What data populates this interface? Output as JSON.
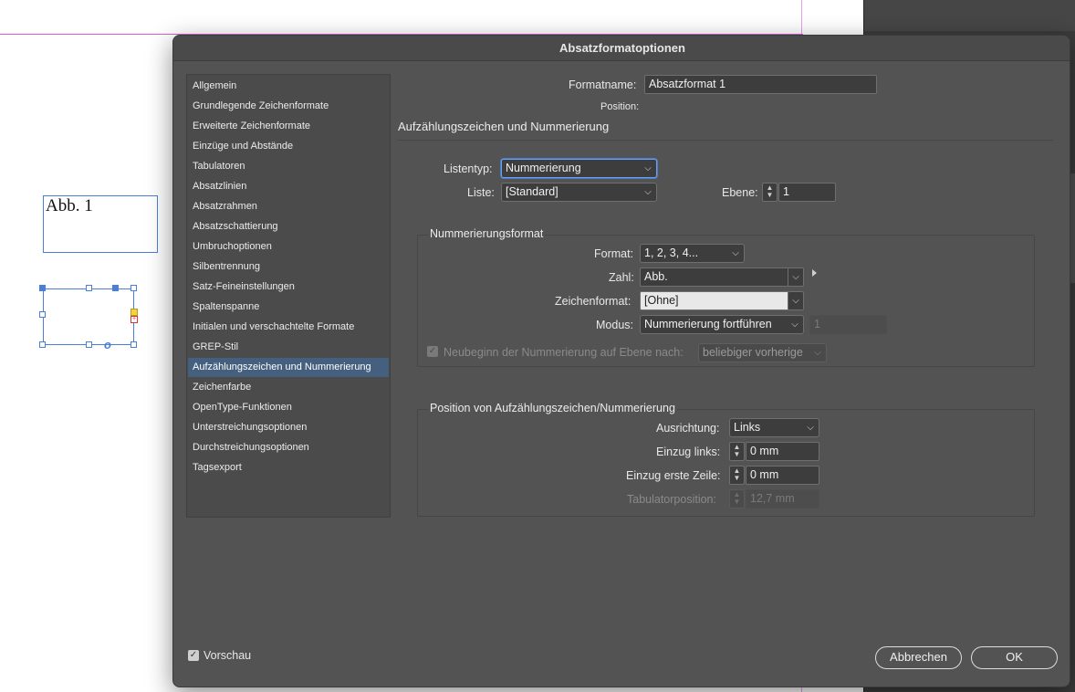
{
  "document": {
    "frame_text": "Abb. 1"
  },
  "dialog": {
    "title": "Absatzformatoptionen",
    "categories": [
      "Allgemein",
      "Grundlegende Zeichenformate",
      "Erweiterte Zeichenformate",
      "Einzüge und Abstände",
      "Tabulatoren",
      "Absatzlinien",
      "Absatzrahmen",
      "Absatzschattierung",
      "Umbruchoptionen",
      "Silbentrennung",
      "Satz-Feineinstellungen",
      "Spaltenspanne",
      "Initialen und verschachtelte Formate",
      "GREP-Stil",
      "Aufzählungszeichen und Nummerierung",
      "Zeichenfarbe",
      "OpenType-Funktionen",
      "Unterstreichungsoptionen",
      "Durchstreichungsoptionen",
      "Tagsexport"
    ],
    "selected_category": "Aufzählungszeichen und Nummerierung",
    "format_name_label": "Formatname:",
    "format_name_value": "Absatzformat 1",
    "position_label": "Position:",
    "section_title": "Aufzählungszeichen und Nummerierung",
    "listentyp_label": "Listentyp:",
    "listentyp_value": "Nummerierung",
    "liste_label": "Liste:",
    "liste_value": "[Standard]",
    "ebene_label": "Ebene:",
    "ebene_value": "1",
    "numbering_group": {
      "title": "Nummerierungsformat",
      "format_label": "Format:",
      "format_value": "1, 2, 3, 4...",
      "zahl_label": "Zahl:",
      "zahl_value": "Abb.",
      "zeichenformat_label": "Zeichenformat:",
      "zeichenformat_value": "[Ohne]",
      "modus_label": "Modus:",
      "modus_value": "Nummerierung fortführen",
      "modus_start_value": "1",
      "restart_label": "Neubeginn der Nummerierung auf Ebene nach:",
      "restart_checked": true,
      "restart_value": "beliebiger vorherige"
    },
    "position_group": {
      "title": "Position von Aufzählungszeichen/Nummerierung",
      "ausrichtung_label": "Ausrichtung:",
      "ausrichtung_value": "Links",
      "einzug_links_label": "Einzug links:",
      "einzug_links_value": "0 mm",
      "einzug_erste_label": "Einzug erste Zeile:",
      "einzug_erste_value": "0 mm",
      "tab_label": "Tabulatorposition:",
      "tab_value": "12,7 mm"
    },
    "preview_label": "Vorschau",
    "preview_checked": true,
    "cancel_label": "Abbrechen",
    "ok_label": "OK"
  },
  "icons": {
    "chevron": "chevron-down-icon",
    "stepper": "stepper-icon",
    "check": "check-icon",
    "flyout": "triangle-right-icon"
  },
  "colors": {
    "dialog_bg": "#535353",
    "selection": "#45607f",
    "frame_blue": "#4a7fd8",
    "guide_magenta": "#d75fd7"
  }
}
